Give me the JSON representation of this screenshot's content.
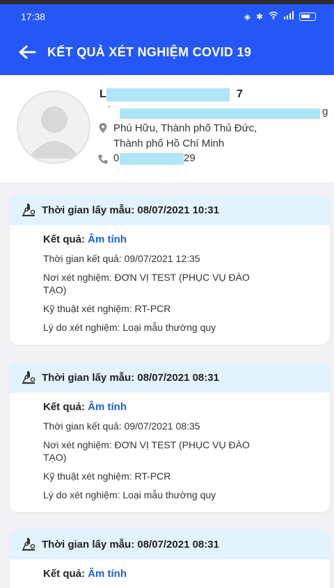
{
  "status_bar": {
    "time": "17:38"
  },
  "header": {
    "title": "KẾT QUẢ XÉT NGHIỆM COVID 19"
  },
  "profile": {
    "name_partial_start": "L",
    "name_partial_end": "7",
    "line2_partial": "g",
    "address_line1": "Phú Hữu, Thành phố Thủ Đức,",
    "address_line2": "Thành phố Hồ Chí Minh",
    "phone_partial_start": "0",
    "phone_partial_end": "29"
  },
  "results": [
    {
      "sample_time_label": "Thời gian lấy mẫu: 08/07/2021 10:31",
      "result_label": "Kết quả: ",
      "result_value": "Âm tính",
      "result_time": "Thời gian kết quả: 09/07/2021 12:35",
      "location_line1": "Nơi xét nghiệm: ĐƠN VỊ TEST (PHỤC VỤ ĐÀO",
      "location_line2": "TẠO)",
      "technique": "Kỹ thuật xét nghiệm: RT-PCR",
      "reason": "Lý do xét nghiệm: Loại mẫu thường quy"
    },
    {
      "sample_time_label": "Thời gian lấy mẫu: 08/07/2021 08:31",
      "result_label": "Kết quả: ",
      "result_value": "Âm tính",
      "result_time": "Thời gian kết quả: 09/07/2021 08:35",
      "location_line1": "Nơi xét nghiệm: ĐƠN VỊ TEST (PHỤC VỤ ĐÀO",
      "location_line2": "TẠO)",
      "technique": "Kỹ thuật xét nghiệm: RT-PCR",
      "reason": "Lý do xét nghiệm: Loại mẫu thường quy"
    },
    {
      "sample_time_label": "Thời gian lấy mẫu: 08/07/2021 08:31",
      "result_label": "Kết quả: ",
      "result_value": "Âm tính"
    }
  ],
  "colors": {
    "primary": "#2457f5",
    "card_header": "#e3f3fd",
    "result_positive_text": "#1f5fd9",
    "redaction": "#aee5f7"
  },
  "icons": [
    "back-arrow-icon",
    "bluetooth-icon",
    "wifi-icon",
    "signal-icon",
    "battery-icon",
    "avatar-placeholder-icon",
    "location-pin-icon",
    "phone-icon",
    "microscope-icon"
  ]
}
